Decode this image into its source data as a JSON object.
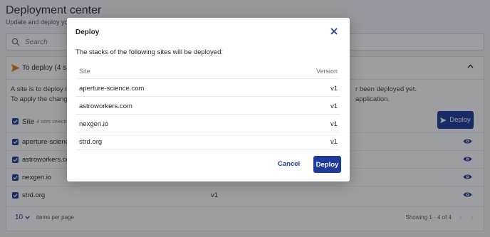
{
  "page": {
    "title": "Deployment center",
    "subtitle": "Update and deploy your s"
  },
  "search": {
    "placeholder": "Search"
  },
  "panel": {
    "title": "To deploy (4 site",
    "info_line1": "A site is to deploy if a",
    "info_line1_right": "r been deployed yet.",
    "info_line2": "To apply the changes",
    "info_line2_right": "application.",
    "site_header": "Site",
    "selected_label": "4 sites selected",
    "deploy_button": "Deploy",
    "rows": [
      {
        "name": "aperture-science",
        "version": ""
      },
      {
        "name": "astroworkers.co",
        "version": ""
      },
      {
        "name": "nexgen.io",
        "version": ""
      },
      {
        "name": "strd.org",
        "version": "v1"
      }
    ],
    "per_page_value": "10",
    "per_page_label": "items per page",
    "showing": "Showing 1 - 4 of 4"
  },
  "modal": {
    "title": "Deploy",
    "description": "The stacks of the following sites will be deployed:",
    "col_site": "Site",
    "col_version": "Version",
    "rows": [
      {
        "site": "aperture-science.com",
        "version": "v1"
      },
      {
        "site": "astroworkers.com",
        "version": "v1"
      },
      {
        "site": "nexgen.io",
        "version": "v1"
      },
      {
        "site": "strd.org",
        "version": "v1"
      }
    ],
    "cancel": "Cancel",
    "deploy": "Deploy"
  },
  "colors": {
    "primary": "#1e3a9a",
    "accent_orange": "#f07d1a"
  }
}
